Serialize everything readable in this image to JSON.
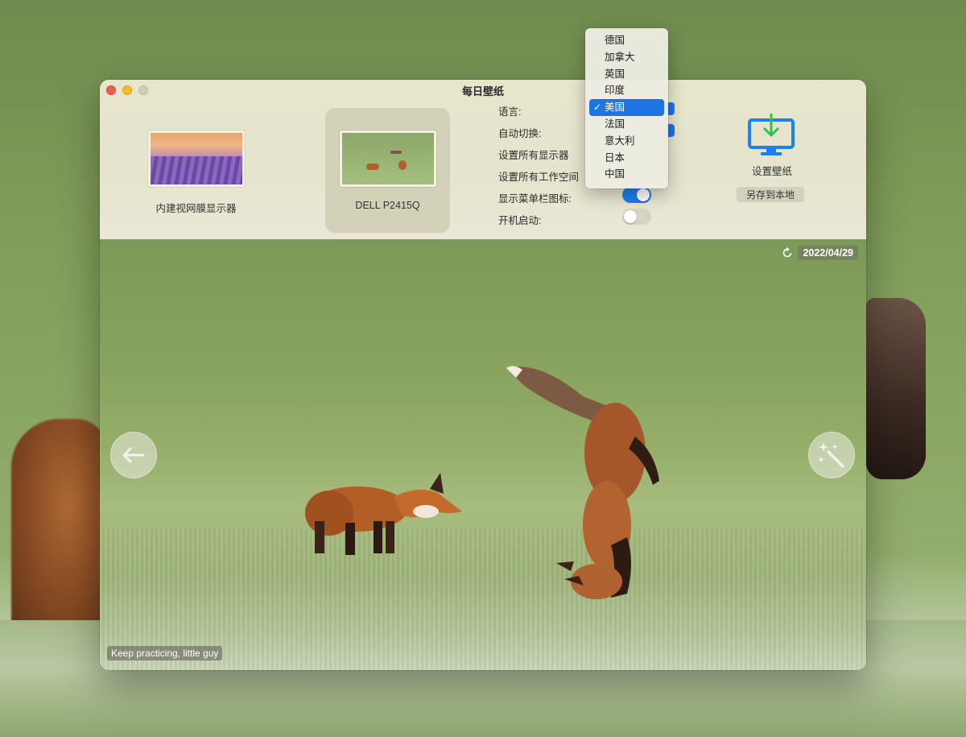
{
  "window": {
    "title": "每日壁纸"
  },
  "displays": [
    {
      "label": "内建视网膜显示器",
      "selected": false
    },
    {
      "label": "DELL P2415Q",
      "selected": true
    }
  ],
  "settings": {
    "language_label": "语言:",
    "auto_switch_label": "自动切换:",
    "all_displays_label": "设置所有显示器",
    "all_spaces_label": "设置所有工作空间",
    "menubar_icon_label": "显示菜单栏图标:",
    "menubar_icon_on": true,
    "launch_at_login_label": "开机启动:",
    "launch_at_login_on": false
  },
  "actions": {
    "set_wallpaper_label": "设置壁纸",
    "save_local_label": "另存到本地"
  },
  "photo": {
    "date": "2022/04/29",
    "caption": "Keep practicing, little guy"
  },
  "language_menu": {
    "selected_index": 4,
    "items": [
      "德国",
      "加拿大",
      "英国",
      "印度",
      "美国",
      "法国",
      "意大利",
      "日本",
      "中国"
    ]
  },
  "colors": {
    "accent": "#1f74e3",
    "toggle_on": "#1f7ff0",
    "monitor_icon": "#1a82f0",
    "download_arrow": "#2fc24b"
  },
  "icons": {
    "refresh": "refresh-icon",
    "prev": "arrow-left-icon",
    "magic": "magic-wand-icon",
    "set_wallpaper": "monitor-download-icon"
  }
}
